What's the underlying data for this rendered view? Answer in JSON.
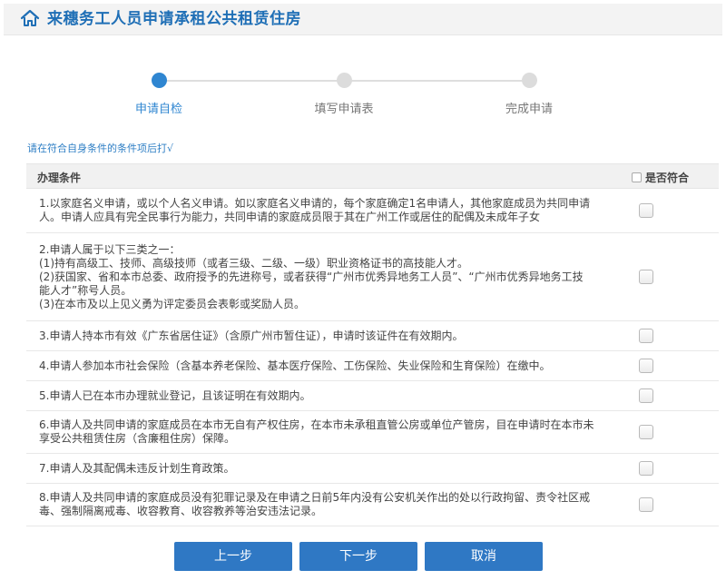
{
  "header": {
    "title": "来穗务工人员申请承租公共租赁住房",
    "icon": "home-icon",
    "accent_color": "#1f6fb6"
  },
  "steps": [
    {
      "label": "申请自检",
      "active": true
    },
    {
      "label": "填写申请表",
      "active": false
    },
    {
      "label": "完成申请",
      "active": false
    }
  ],
  "hint": "请在符合自身条件的条件项后打√",
  "table": {
    "col_condition": "办理条件",
    "col_match": "是否符合",
    "rows": [
      {
        "lines": [
          "1.以家庭名义申请，或以个人名义申请。如以家庭名义申请的，每个家庭确定1名申请人，其他家庭成员为共同申请",
          "人。申请人应具有完全民事行为能力，共同申请的家庭成员限于其在广州工作或居住的配偶及未成年子女"
        ],
        "checked": false
      },
      {
        "lines": [
          "2.申请人属于以下三类之一：",
          "(1)持有高级工、技师、高级技师（或者三级、二级、一级）职业资格证书的高技能人才。",
          "(2)获国家、省和本市总委、政府授予的先进称号，或者获得“广州市优秀异地务工人员”、“广州市优秀异地务工技",
          "能人才”称号人员。",
          "(3)在本市及以上见义勇为评定委员会表彰或奖励人员。"
        ],
        "checked": false
      },
      {
        "lines": [
          "3.申请人持本市有效《广东省居住证》（含原广州市暂住证），申请时该证件在有效期内。"
        ],
        "checked": false
      },
      {
        "lines": [
          "4.申请人参加本市社会保险（含基本养老保险、基本医疗保险、工伤保险、失业保险和生育保险）在缴中。"
        ],
        "checked": false
      },
      {
        "lines": [
          "5.申请人已在本市办理就业登记，且该证明在有效期内。"
        ],
        "checked": false
      },
      {
        "lines": [
          "6.申请人及共同申请的家庭成员在本市无自有产权住房，在本市未承租直管公房或单位产管房，目在申请时在本市未",
          "享受公共租赁住房（含廉租住房）保障。"
        ],
        "checked": false
      },
      {
        "lines": [
          "7.申请人及其配偶未违反计划生育政策。"
        ],
        "checked": false
      },
      {
        "lines": [
          "8.申请人及共同申请的家庭成员没有犯罪记录及在申请之日前5年内没有公安机关作出的处以行政拘留、责令社区戒",
          "毒、强制隔离戒毒、收容教育、收容教养等治安违法记录。"
        ],
        "checked": false
      }
    ]
  },
  "buttons": {
    "prev": "上一步",
    "next": "下一步",
    "cancel": "取消"
  },
  "colors": {
    "primary": "#2f78c4",
    "active_step": "#2f86d1",
    "inactive_step": "#dcdcdc"
  }
}
